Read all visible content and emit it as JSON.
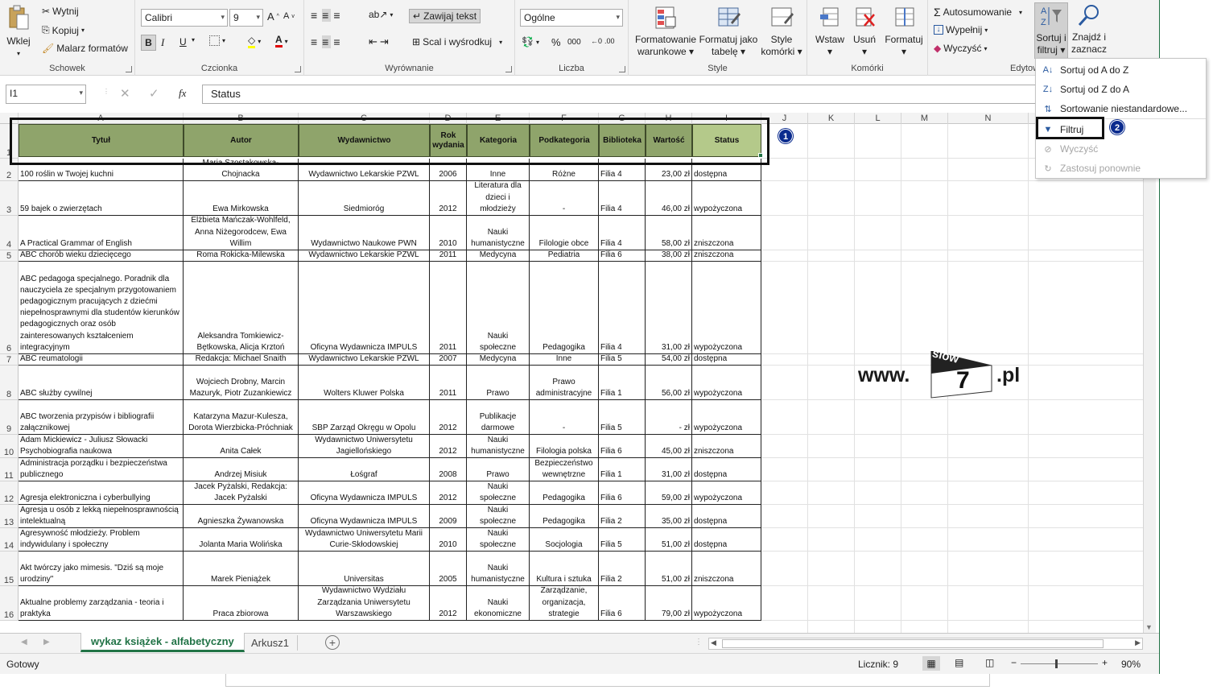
{
  "ribbon": {
    "clipboard": {
      "paste": "Wklej",
      "cut": "Wytnij",
      "copy": "Kopiuj",
      "painter": "Malarz formatów",
      "group": "Schowek"
    },
    "font": {
      "name": "Calibri",
      "size": "9",
      "bold": "B",
      "italic": "I",
      "underline": "U",
      "group": "Czcionka"
    },
    "alignment": {
      "wrap": "Zawijaj tekst",
      "merge": "Scal i wyśrodkuj",
      "group": "Wyrównanie"
    },
    "number": {
      "format": "Ogólne",
      "percent": "%",
      "thousands": "000",
      "group": "Liczba"
    },
    "styles": {
      "cond_l1": "Formatowanie",
      "cond_l2": "warunkowe",
      "table_l1": "Formatuj jako",
      "table_l2": "tabelę",
      "cell_l1": "Style",
      "cell_l2": "komórki",
      "group": "Style"
    },
    "cells": {
      "insert": "Wstaw",
      "delete": "Usuń",
      "format": "Formatuj",
      "group": "Komórki"
    },
    "editing": {
      "autosum": "Autosumowanie",
      "fill": "Wypełnij",
      "clear": "Wyczyść",
      "sort_l1": "Sortuj i",
      "sort_l2": "filtruj",
      "find_l1": "Znajdź i",
      "find_l2": "zaznacz",
      "group": "Edytowanie"
    }
  },
  "formula_bar": {
    "namebox": "I1",
    "fx": "fx",
    "value": "Status"
  },
  "columns": [
    "A",
    "B",
    "C",
    "D",
    "E",
    "F",
    "G",
    "H",
    "I",
    "J",
    "K",
    "L",
    "M",
    "N"
  ],
  "header_row": [
    "Tytuł",
    "Autor",
    "Wydawnictwo",
    "Rok wydania",
    "Kategoria",
    "Podkategoria",
    "Biblioteka",
    "Wartość",
    "Status"
  ],
  "rows": [
    {
      "n": "2",
      "cells": [
        "100 roślin w Twojej kuchni",
        "Maria Szostakowska-Chojnacka",
        "Wydawnictwo Lekarskie PZWL",
        "2006",
        "Inne",
        "Różne",
        "Filia 4",
        "23,00 zł",
        "dostępna"
      ]
    },
    {
      "n": "3",
      "cells": [
        "59 bajek o zwierzętach",
        "Ewa Mirkowska",
        "Siedmioróg",
        "2012",
        "Literatura dla dzieci i młodzieży",
        "-",
        "Filia 4",
        "46,00 zł",
        "wypożyczona"
      ]
    },
    {
      "n": "4",
      "cells": [
        "A Practical Grammar of English",
        "Elżbieta Mańczak-Wohlfeld, Anna Niżegorodcew, Ewa Willim",
        "Wydawnictwo Naukowe PWN",
        "2010",
        "Nauki humanistyczne",
        "Filologie obce",
        "Filia 4",
        "58,00 zł",
        "zniszczona"
      ]
    },
    {
      "n": "5",
      "cells": [
        "ABC chorób wieku dziecięcego",
        "Roma Rokicka-Milewska",
        "Wydawnictwo Lekarskie PZWL",
        "2011",
        "Medycyna",
        "Pediatria",
        "Filia 6",
        "38,00 zł",
        "zniszczona"
      ]
    },
    {
      "n": "6",
      "cells": [
        "ABC pedagoga specjalnego. Poradnik dla nauczyciela ze specjalnym przygotowaniem pedagogicznym pracujących z dziećmi niepełnosprawnymi dla studentów kierunków pedagogicznych oraz osób zainteresowanych kształceniem integracyjnym",
        "Aleksandra Tomkiewicz-Bętkowska, Alicja Krztoń",
        "Oficyna Wydawnicza IMPULS",
        "2011",
        "Nauki społeczne",
        "Pedagogika",
        "Filia 4",
        "31,00 zł",
        "wypożyczona"
      ]
    },
    {
      "n": "7",
      "cells": [
        "ABC reumatologii",
        "Redakcja: Michael Snaith",
        "Wydawnictwo Lekarskie PZWL",
        "2007",
        "Medycyna",
        "Inne",
        "Filia 5",
        "54,00 zł",
        "dostępna"
      ]
    },
    {
      "n": "8",
      "cells": [
        "ABC służby cywilnej",
        "Wojciech Drobny, Marcin Mazuryk, Piotr Zuzankiewicz",
        "Wolters Kluwer Polska",
        "2011",
        "Prawo",
        "Prawo administracyjne",
        "Filia 1",
        "56,00 zł",
        "wypożyczona"
      ]
    },
    {
      "n": "9",
      "cells": [
        "ABC tworzenia przypisów i bibliografii załącznikowej",
        "Katarzyna Mazur-Kulesza, Dorota Wierzbicka-Próchniak",
        "SBP Zarząd Okręgu w Opolu",
        "2012",
        "Publikacje darmowe",
        "-",
        "Filia 5",
        "-   zł",
        "wypożyczona"
      ]
    },
    {
      "n": "10",
      "cells": [
        "Adam Mickiewicz - Juliusz Słowacki Psychobiografia naukowa",
        "Anita Całek",
        "Wydawnictwo Uniwersytetu Jagiellońskiego",
        "2012",
        "Nauki humanistyczne",
        "Filologia polska",
        "Filia 6",
        "45,00 zł",
        "zniszczona"
      ]
    },
    {
      "n": "11",
      "cells": [
        "Administracja porządku i bezpieczeństwa publicznego",
        "Andrzej Misiuk",
        "Łośgraf",
        "2008",
        "Prawo",
        "Bezpieczeństwo wewnętrzne",
        "Filia 1",
        "31,00 zł",
        "dostępna"
      ]
    },
    {
      "n": "12",
      "cells": [
        "Agresja elektroniczna i cyberbullying",
        "Jacek Pyżalski, Redakcja: Jacek Pyżalski",
        "Oficyna Wydawnicza IMPULS",
        "2012",
        "Nauki społeczne",
        "Pedagogika",
        "Filia 6",
        "59,00 zł",
        "wypożyczona"
      ]
    },
    {
      "n": "13",
      "cells": [
        "Agresja u osób z lekką niepełnosprawnością intelektualną",
        "Agnieszka Żywanowska",
        "Oficyna Wydawnicza IMPULS",
        "2009",
        "Nauki społeczne",
        "Pedagogika",
        "Filia 2",
        "35,00 zł",
        "dostępna"
      ]
    },
    {
      "n": "14",
      "cells": [
        "Agresywność młodzieży. Problem indywidulany i społeczny",
        "Jolanta Maria Wolińska",
        "Wydawnictwo Uniwersytetu Marii Curie-Skłodowskiej",
        "2010",
        "Nauki społeczne",
        "Socjologia",
        "Filia 5",
        "51,00 zł",
        "dostępna"
      ]
    },
    {
      "n": "15",
      "cells": [
        "Akt twórczy jako mimesis. \"Dziś są moje urodziny\"",
        "Marek Pieniążek",
        "Universitas",
        "2005",
        "Nauki humanistyczne",
        "Kultura i sztuka",
        "Filia 2",
        "51,00 zł",
        "zniszczona"
      ]
    },
    {
      "n": "16",
      "cells": [
        "Aktualne problemy zarządzania - teoria i praktyka",
        "Praca zbiorowa",
        "Wydawnictwo Wydziału Zarządzania Uniwersytetu Warszawskiego",
        "2012",
        "Nauki ekonomiczne",
        "Zarządzanie, organizacja, strategie",
        "Filia 6",
        "79,00 zł",
        "wypożyczona"
      ]
    }
  ],
  "sort_menu": {
    "items": [
      {
        "label": "Sortuj od A do Z",
        "enabled": true
      },
      {
        "label": "Sortuj od Z do A",
        "enabled": true
      },
      {
        "label": "Sortowanie niestandardowe...",
        "enabled": true
      },
      {
        "label": "Filtruj",
        "enabled": true
      },
      {
        "label": "Wyczyść",
        "enabled": false
      },
      {
        "label": "Zastosuj ponownie",
        "enabled": false
      }
    ]
  },
  "badges": {
    "one": "1",
    "two": "2"
  },
  "watermark": {
    "left": "www.",
    "logo_top": "slow",
    "logo_num": "7",
    "right": ".pl"
  },
  "sheets": {
    "active": "wykaz książek - alfabetyczny",
    "other": "Arkusz1"
  },
  "statusbar": {
    "ready": "Gotowy",
    "count": "Licznik: 9",
    "zoom": "90%"
  },
  "colors": {
    "header_fill": "#8fa46b",
    "accent": "#217346",
    "badge": "#0a2b8e"
  }
}
